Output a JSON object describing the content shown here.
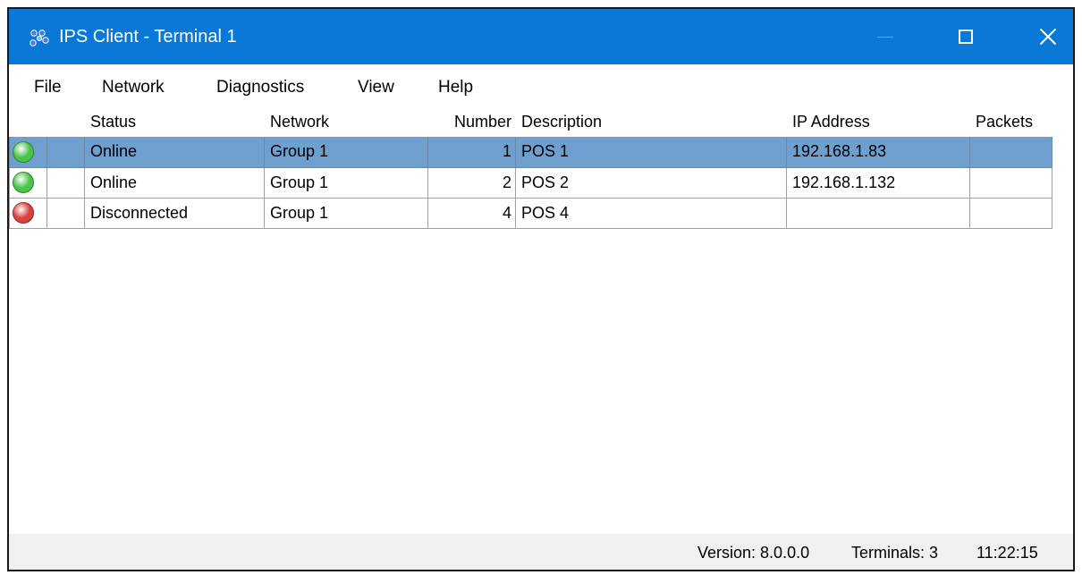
{
  "window": {
    "title": "IPS Client - Terminal 1",
    "titlebar_color": "#0a78d7",
    "icons": {
      "app": "network-nodes-icon",
      "minimize": "minimize-icon",
      "maximize": "maximize-icon",
      "close": "close-icon"
    }
  },
  "menu": {
    "items": [
      {
        "label": "File"
      },
      {
        "label": "Network"
      },
      {
        "label": "Diagnostics"
      },
      {
        "label": "View"
      },
      {
        "label": "Help"
      }
    ]
  },
  "table": {
    "columns": [
      "",
      "",
      "Status",
      "Network",
      "Number",
      "Description",
      "IP Address",
      "Packets"
    ],
    "rows": [
      {
        "light": "green",
        "status": "Online",
        "network": "Group 1",
        "number": "1",
        "description": "POS 1",
        "ip": "192.168.1.83",
        "packets": "",
        "selected": true
      },
      {
        "light": "green",
        "status": "Online",
        "network": "Group 1",
        "number": "2",
        "description": "POS 2",
        "ip": "192.168.1.132",
        "packets": "",
        "selected": false
      },
      {
        "light": "red",
        "status": "Disconnected",
        "network": "Group 1",
        "number": "4",
        "description": "POS 4",
        "ip": "",
        "packets": "",
        "selected": false
      }
    ],
    "selection_color": "#6f9fcf",
    "status_colors": {
      "green": "#4cc44c",
      "red": "#d94040"
    }
  },
  "statusbar": {
    "version": "Version: 8.0.0.0",
    "terminals": "Terminals: 3",
    "time": "11:22:15"
  }
}
